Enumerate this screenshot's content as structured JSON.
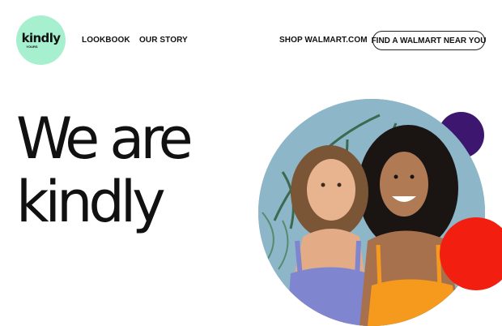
{
  "logo": {
    "word": "kindly",
    "sub": "YOURS"
  },
  "nav": {
    "lookbook": "LOOKBOOK",
    "our_story": "OUR STORY",
    "shop": "SHOP WALMART.COM",
    "find": "FIND A WALMART NEAR YOU"
  },
  "hero": {
    "headline_line1": "We are",
    "headline_line2": "kindly",
    "image_icon": "two-women-photo",
    "accent_colors": {
      "mint": "#a7f0cf",
      "purple": "#3d1670",
      "red": "#f21e10"
    }
  }
}
